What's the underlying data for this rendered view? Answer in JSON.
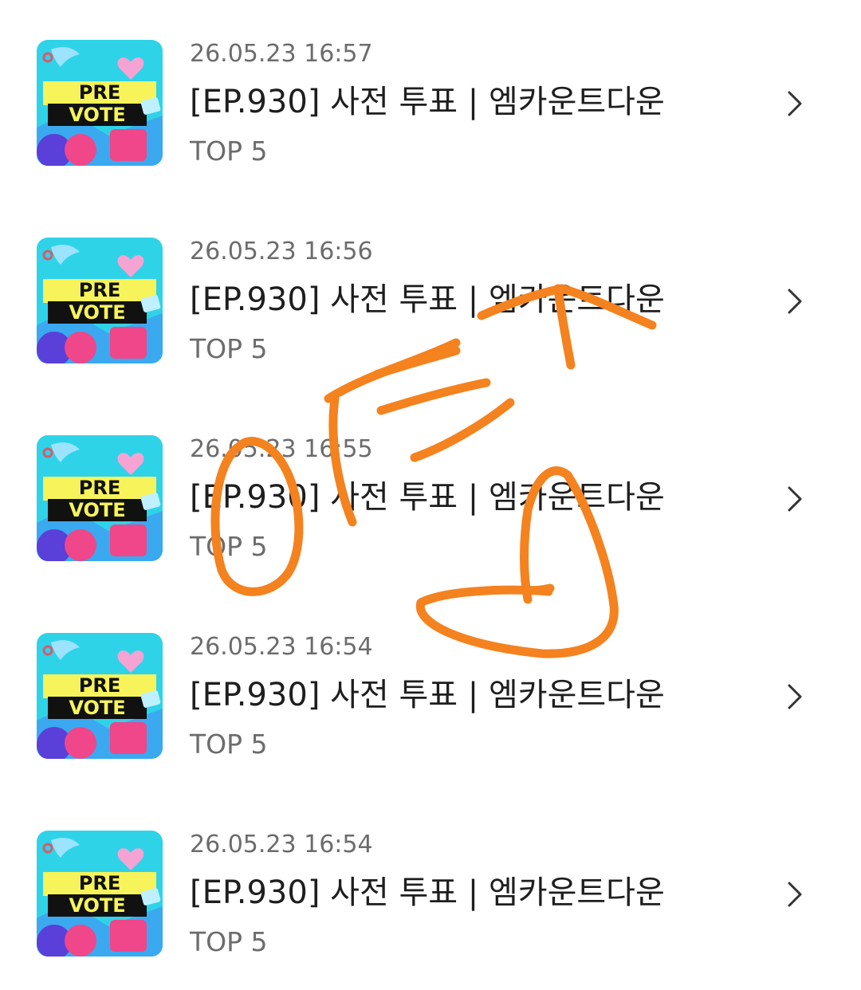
{
  "colors": {
    "annotation": "#F4821F",
    "thumb_cyan": "#2FD3E8",
    "thumb_pink": "#F0468A",
    "thumb_yellow": "#F6F45A",
    "thumb_purple": "#5B3FD9"
  },
  "thumbnail": {
    "line1": "PRE",
    "line2": "VOTE"
  },
  "items": [
    {
      "datetime": "26.05.23 16:57",
      "title": "[EP.930] 사전 투표 | 엠카운트다운",
      "subtitle": "TOP 5",
      "icon": "chevron-right-icon"
    },
    {
      "datetime": "26.05.23 16:56",
      "title": "[EP.930] 사전 투표 | 엠카운트다운",
      "subtitle": "TOP 5",
      "icon": "chevron-right-icon"
    },
    {
      "datetime": "26.05.23 16:55",
      "title": "[EP.930] 사전 투표 | 엠카운트다운",
      "subtitle": "TOP 5",
      "icon": "chevron-right-icon"
    },
    {
      "datetime": "26.05.23 16:54",
      "title": "[EP.930] 사전 투표 | 엠카운트다운",
      "subtitle": "TOP 5",
      "icon": "chevron-right-icon"
    },
    {
      "datetime": "26.05.23 16:54",
      "title": "[EP.930] 사전 투표 | 엠카운트다운",
      "subtitle": "TOP 5",
      "icon": "chevron-right-icon"
    }
  ]
}
